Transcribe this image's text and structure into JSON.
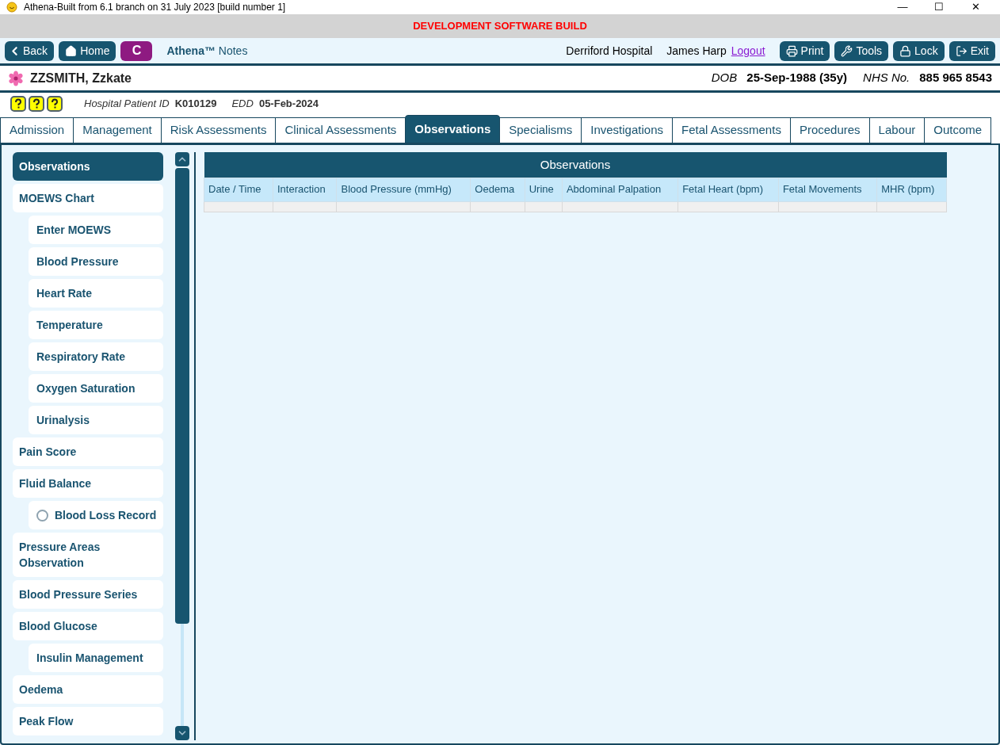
{
  "window": {
    "title": "Athena-Built from 6.1 branch on 31 July 2023 [build number 1]",
    "controls": [
      "—",
      "☐",
      "✕"
    ]
  },
  "banner": "DEVELOPMENT SOFTWARE BUILD",
  "toolbar": {
    "back": "Back",
    "home": "Home",
    "c_button": "C",
    "app_name": "Athena™",
    "app_suffix": "Notes",
    "hospital": "Derriford Hospital",
    "user": "James Harp",
    "logout": "Logout",
    "buttons": [
      {
        "kind": "print",
        "label": "Print"
      },
      {
        "kind": "tools",
        "label": "Tools"
      },
      {
        "kind": "lock",
        "label": "Lock"
      },
      {
        "kind": "exit",
        "label": "Exit"
      }
    ]
  },
  "patient": {
    "name": "ZZSMITH, Zzkate",
    "dob_label": "DOB",
    "dob": "25-Sep-1988 (35y)",
    "nhs_label": "NHS No.",
    "nhs": "885 965 8543"
  },
  "info": {
    "hospital_id_label": "Hospital Patient ID",
    "hospital_id": "K010129",
    "edd_label": "EDD",
    "edd": "05-Feb-2024"
  },
  "tabs": [
    {
      "label": "Admission",
      "selected": false
    },
    {
      "label": "Management",
      "selected": false
    },
    {
      "label": "Risk Assessments",
      "selected": false
    },
    {
      "label": "Clinical Assessments",
      "selected": false
    },
    {
      "label": "Observations",
      "selected": true
    },
    {
      "label": "Specialisms",
      "selected": false
    },
    {
      "label": "Investigations",
      "selected": false
    },
    {
      "label": "Fetal Assessments",
      "selected": false
    },
    {
      "label": "Procedures",
      "selected": false
    },
    {
      "label": "Labour",
      "selected": false
    },
    {
      "label": "Outcome",
      "selected": false
    }
  ],
  "sidebar": {
    "items": [
      {
        "label": "Observations",
        "selected": true
      },
      {
        "label": "MOEWS Chart",
        "selected": false,
        "children": [
          {
            "label": "Enter MOEWS",
            "selected": false
          },
          {
            "label": "Blood Pressure",
            "selected": false
          },
          {
            "label": "Heart Rate",
            "selected": false
          },
          {
            "label": "Temperature",
            "selected": false
          },
          {
            "label": "Respiratory Rate",
            "selected": false
          },
          {
            "label": "Oxygen Saturation",
            "selected": false
          },
          {
            "label": "Urinalysis",
            "selected": false
          }
        ]
      },
      {
        "label": "Pain Score",
        "selected": false
      },
      {
        "label": "Fluid Balance",
        "selected": false,
        "children": [
          {
            "label": "Blood Loss Record",
            "selected": false,
            "kind": "radio",
            "checked": false
          }
        ]
      },
      {
        "label": "Pressure Areas Observation",
        "selected": false
      },
      {
        "label": "Blood Pressure Series",
        "selected": false
      },
      {
        "label": "Blood Glucose",
        "selected": false,
        "children": [
          {
            "label": "Insulin Management",
            "selected": false
          }
        ]
      },
      {
        "label": "Oedema",
        "selected": false
      },
      {
        "label": "Peak Flow",
        "selected": false
      }
    ]
  },
  "table": {
    "title": "Observations",
    "columns": [
      "Date / Time",
      "Interaction",
      "Blood Pressure (mmHg)",
      "Oedema",
      "Urine",
      "Abdominal Palpation",
      "Fetal Heart (bpm)",
      "Fetal Movements",
      "MHR (bpm)"
    ]
  }
}
